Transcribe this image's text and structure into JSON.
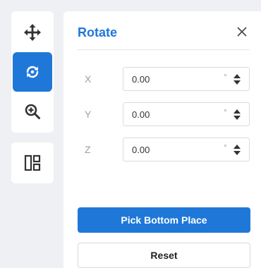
{
  "toolbar": {
    "tools": [
      {
        "icon": "move-icon",
        "active": false
      },
      {
        "icon": "rotate-icon",
        "active": true
      },
      {
        "icon": "zoom-in-icon",
        "active": false
      }
    ],
    "secondary_tools": [
      {
        "icon": "layout-icon",
        "active": false
      }
    ]
  },
  "panel": {
    "title": "Rotate",
    "close_icon": "close-icon",
    "axes": [
      {
        "label": "X",
        "value": "0.00",
        "unit": "°"
      },
      {
        "label": "Y",
        "value": "0.00",
        "unit": "°"
      },
      {
        "label": "Z",
        "value": "0.00",
        "unit": "°"
      }
    ],
    "pick_bottom_label": "Pick Bottom Place",
    "reset_label": "Reset"
  },
  "colors": {
    "accent": "#1f78d8",
    "background": "#eef0f3"
  }
}
